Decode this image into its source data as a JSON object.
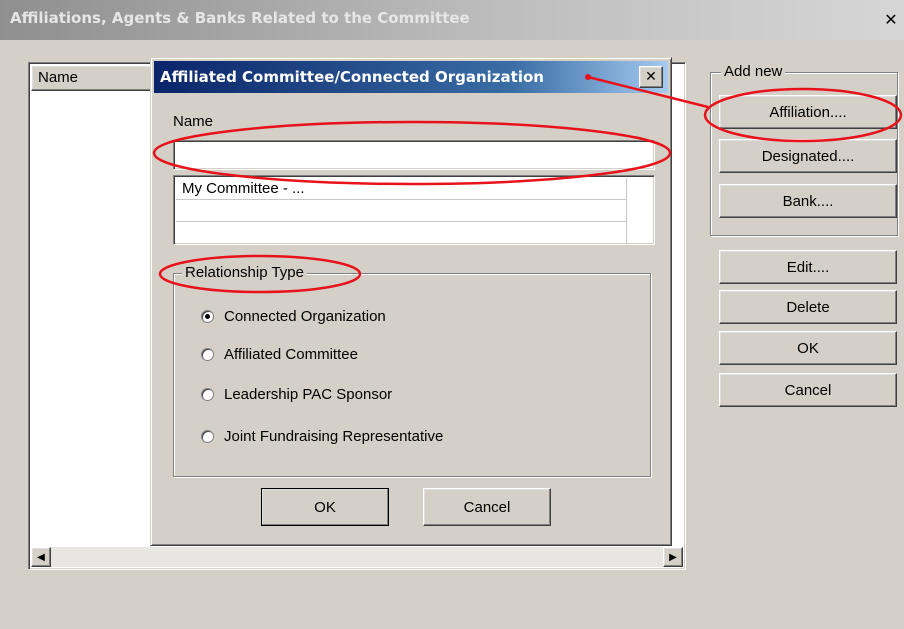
{
  "outer_window": {
    "title": "Affiliations, Agents & Banks Related to the Committee",
    "close_glyph": "✕"
  },
  "background_list": {
    "column_header": "Name"
  },
  "add_new_group": {
    "legend": "Add new",
    "buttons": [
      "Affiliation....",
      "Designated....",
      "Bank...."
    ]
  },
  "side_buttons": [
    "Edit....",
    "Delete",
    "OK",
    "Cancel"
  ],
  "dialog": {
    "title": "Affiliated Committee/Connected Organization",
    "close_glyph": "✕",
    "name_label": "Name",
    "name_value": "",
    "list_rows": [
      "My Committee - ...",
      "",
      ""
    ],
    "relationship_legend": "Relationship Type",
    "relationship_options": [
      {
        "label": "Connected Organization",
        "selected": true
      },
      {
        "label": "Affiliated Committee",
        "selected": false
      },
      {
        "label": "Leadership PAC Sponsor",
        "selected": false
      },
      {
        "label": "Joint Fundraising Representative",
        "selected": false
      }
    ],
    "ok_label": "OK",
    "cancel_label": "Cancel"
  },
  "annotation_color": "#e8121b"
}
